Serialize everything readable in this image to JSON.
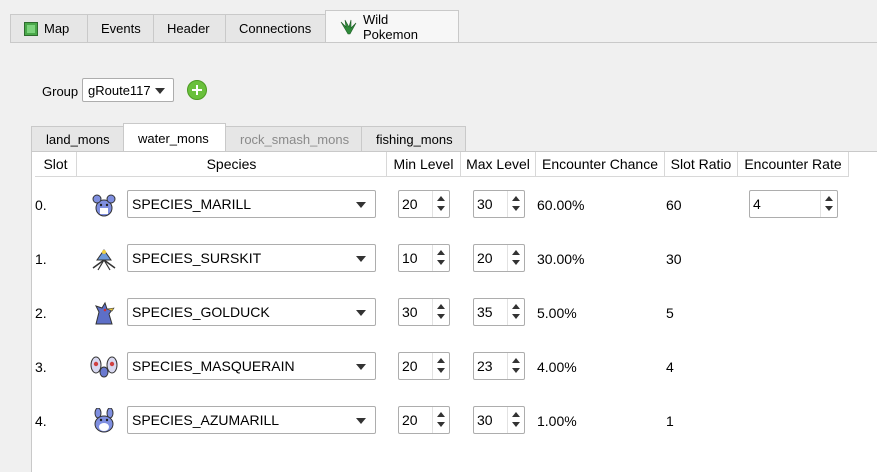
{
  "top_tabs": [
    {
      "label": "Map",
      "icon": "map-icon"
    },
    {
      "label": "Events"
    },
    {
      "label": "Header"
    },
    {
      "label": "Connections"
    },
    {
      "label": "Wild Pokemon",
      "icon": "grass-icon",
      "active": true
    }
  ],
  "group": {
    "label": "Group",
    "value": "gRoute117"
  },
  "sub_tabs": [
    {
      "label": "land_mons"
    },
    {
      "label": "water_mons",
      "active": true
    },
    {
      "label": "rock_smash_mons",
      "disabled": true
    },
    {
      "label": "fishing_mons"
    }
  ],
  "columns": [
    "Slot",
    "Species",
    "Min Level",
    "Max Level",
    "Encounter Chance",
    "Slot Ratio",
    "Encounter Rate"
  ],
  "rows": [
    {
      "slot": "0.",
      "species": "SPECIES_MARILL",
      "min": "20",
      "max": "30",
      "chance": "60.00%",
      "ratio": "60",
      "sprite": "marill-sprite"
    },
    {
      "slot": "1.",
      "species": "SPECIES_SURSKIT",
      "min": "10",
      "max": "20",
      "chance": "30.00%",
      "ratio": "30",
      "sprite": "surskit-sprite"
    },
    {
      "slot": "2.",
      "species": "SPECIES_GOLDUCK",
      "min": "30",
      "max": "35",
      "chance": "5.00%",
      "ratio": "5",
      "sprite": "golduck-sprite"
    },
    {
      "slot": "3.",
      "species": "SPECIES_MASQUERAIN",
      "min": "20",
      "max": "23",
      "chance": "4.00%",
      "ratio": "4",
      "sprite": "masquerain-sprite"
    },
    {
      "slot": "4.",
      "species": "SPECIES_AZUMARILL",
      "min": "20",
      "max": "30",
      "chance": "1.00%",
      "ratio": "1",
      "sprite": "azumarill-sprite"
    }
  ],
  "encounter_rate": "4",
  "colors": {
    "accent_green": "#6ac03c",
    "tab_bg": "#e6e6e6",
    "panel_bg": "#ffffff"
  }
}
